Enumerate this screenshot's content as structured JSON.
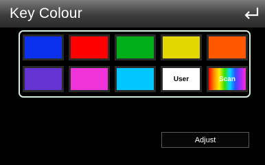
{
  "header": {
    "title": "Key Colour"
  },
  "swatches": [
    {
      "label": "",
      "color": "#0b30ee"
    },
    {
      "label": "",
      "color": "#ff0000"
    },
    {
      "label": "",
      "color": "#00ae1a"
    },
    {
      "label": "",
      "color": "#e2d800"
    },
    {
      "label": "",
      "color": "#ff5800"
    },
    {
      "label": "",
      "color": "#6633d3"
    },
    {
      "label": "",
      "color": "#f032d9"
    },
    {
      "label": "",
      "color": "#00c8ff"
    },
    {
      "label": "User",
      "color": "#ffffff"
    },
    {
      "label": "Scan",
      "color": "rainbow"
    }
  ],
  "adjust_button": {
    "label": "Adjust"
  },
  "icons": {
    "back": "back-arrow-icon"
  }
}
